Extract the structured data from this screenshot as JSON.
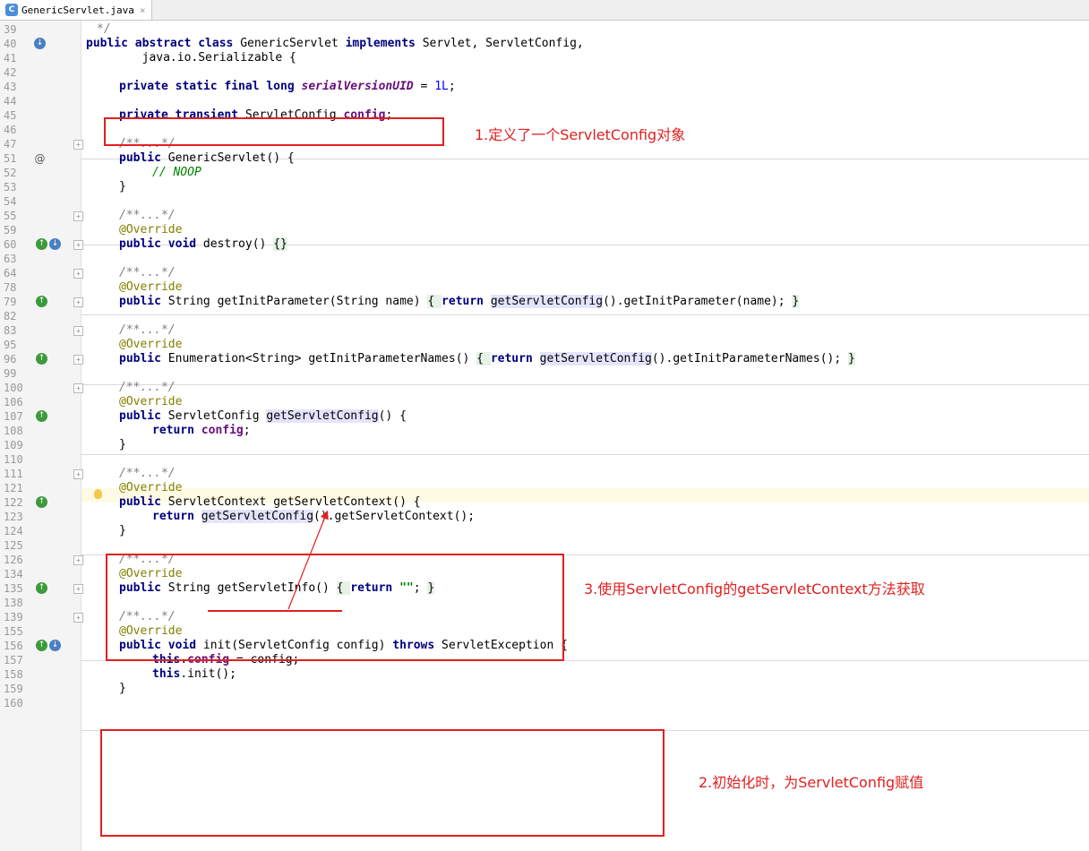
{
  "tab": {
    "icon": "class-icon",
    "icon_letter": "C",
    "title": "GenericServlet.java",
    "close": "×"
  },
  "code": {
    "l39": {
      "num": "39",
      "c": "*/"
    },
    "l40": {
      "num": "40",
      "a": "public abstract class",
      "b": " GenericServlet ",
      "c": "implements",
      "d": " Servlet, ServletConfig,"
    },
    "l41": {
      "num": "41",
      "a": "        java.io.Serializable {"
    },
    "l42": {
      "num": "42"
    },
    "l43": {
      "num": "43",
      "a": "private static final long",
      "b": "serialVersionUID",
      "c": " = ",
      "d": "1L",
      "e": ";"
    },
    "l44": {
      "num": "44"
    },
    "l45": {
      "num": "45",
      "a": "private transient",
      "b": " ServletConfig ",
      "c": "config",
      "d": ";"
    },
    "l46": {
      "num": "46"
    },
    "l47": {
      "num": "47",
      "a": "/**...*/"
    },
    "l51": {
      "num": "51",
      "mark": "@",
      "a": "public",
      "b": " GenericServlet() {"
    },
    "l52": {
      "num": "52",
      "a": "// NOOP"
    },
    "l53": {
      "num": "53",
      "a": "}"
    },
    "l54": {
      "num": "54"
    },
    "l55": {
      "num": "55",
      "a": "/**...*/"
    },
    "l59": {
      "num": "59",
      "a": "@Override"
    },
    "l60": {
      "num": "60",
      "a": "public void",
      "b": " destroy() ",
      "c": "{}"
    },
    "l63": {
      "num": "63"
    },
    "l64": {
      "num": "64",
      "a": "/**...*/"
    },
    "l78": {
      "num": "78",
      "a": "@Override"
    },
    "l79": {
      "num": "79",
      "a": "public",
      "b": " String getInitParameter(String name) ",
      "c": "{ ",
      "d": "return",
      "e": " ",
      "f": "getServletConfig",
      "g": "().getInitParameter(name); ",
      "h": "}"
    },
    "l82": {
      "num": "82"
    },
    "l83": {
      "num": "83",
      "a": "/**...*/"
    },
    "l95": {
      "num": "95",
      "a": "@Override"
    },
    "l96": {
      "num": "96",
      "a": "public",
      "b": " Enumeration<String> getInitParameterNames() ",
      "c": "{ ",
      "d": "return",
      "e": " ",
      "f": "getServletConfig",
      "g": "().getInitParameterNames(); ",
      "h": "}"
    },
    "l99": {
      "num": "99"
    },
    "l100": {
      "num": "100",
      "a": "/**...*/"
    },
    "l106": {
      "num": "106",
      "a": "@Override"
    },
    "l107": {
      "num": "107",
      "a": "public",
      "b": " ServletConfig ",
      "c": "getServletConfig",
      "d": "() {"
    },
    "l108": {
      "num": "108",
      "a": "return",
      "b": " ",
      "c": "config",
      "d": ";"
    },
    "l109": {
      "num": "109",
      "a": "}"
    },
    "l110": {
      "num": "110"
    },
    "l111": {
      "num": "111",
      "a": "/**...*/"
    },
    "l121": {
      "num": "121",
      "a": "@Override"
    },
    "l122": {
      "num": "122",
      "a": "public",
      "b": " ServletContext getServletContext() {"
    },
    "l123": {
      "num": "123",
      "a": "return",
      "b": " ",
      "c": "getServletConfig",
      "d": "().getServletContext();"
    },
    "l124": {
      "num": "124",
      "a": "}"
    },
    "l125": {
      "num": "125"
    },
    "l126": {
      "num": "126",
      "a": "/**...*/"
    },
    "l134": {
      "num": "134",
      "a": "@Override"
    },
    "l135": {
      "num": "135",
      "a": "public",
      "b": " String getServletInfo() ",
      "c": "{ ",
      "d": "return",
      "e": " ",
      "f": "\"\"",
      "g": "; ",
      "h": "}"
    },
    "l138": {
      "num": "138"
    },
    "l139": {
      "num": "139",
      "a": "/**...*/"
    },
    "l155": {
      "num": "155",
      "a": "@Override"
    },
    "l156": {
      "num": "156",
      "a": "public void",
      "b": " init(ServletConfig config) ",
      "c": "throws",
      "d": " ServletException {"
    },
    "l157": {
      "num": "157",
      "a": "this",
      "b": ".",
      "c": "config",
      "d": " = config;"
    },
    "l158": {
      "num": "158",
      "a": "this",
      "b": ".init();"
    },
    "l159": {
      "num": "159",
      "a": "}"
    },
    "l160": {
      "num": "160"
    }
  },
  "annotations": {
    "note1": "1.定义了一个ServletConfig对象",
    "note2": "2.初始化时，为ServletConfig赋值",
    "note3": "3.使用ServletConfig的getServletContext方法获取"
  },
  "colors": {
    "annotation": "#e02020",
    "keyword": "#000080",
    "field": "#660e7a",
    "annotation_java": "#808000"
  }
}
